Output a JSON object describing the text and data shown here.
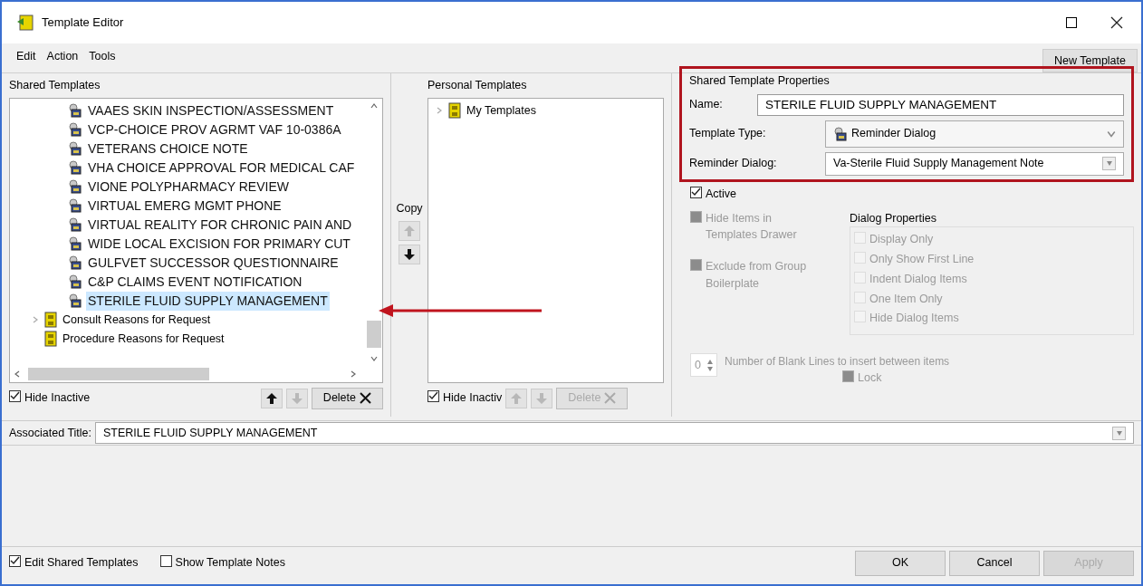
{
  "window": {
    "title": "Template Editor"
  },
  "menu": [
    "Edit",
    "Action",
    "Tools"
  ],
  "new_template_button": "New Template",
  "shared": {
    "label": "Shared Templates",
    "items": [
      {
        "kind": "template",
        "label": "VAAES SKIN INSPECTION/ASSESSMENT",
        "selected": false
      },
      {
        "kind": "template",
        "label": "VCP-CHOICE PROV AGRMT VAF 10-0386A",
        "selected": false
      },
      {
        "kind": "template",
        "label": "VETERANS CHOICE NOTE",
        "selected": false
      },
      {
        "kind": "template",
        "label": "VHA CHOICE APPROVAL FOR MEDICAL CAF",
        "selected": false
      },
      {
        "kind": "template",
        "label": "VIONE POLYPHARMACY REVIEW",
        "selected": false
      },
      {
        "kind": "template",
        "label": "VIRTUAL EMERG MGMT PHONE",
        "selected": false
      },
      {
        "kind": "template",
        "label": "VIRTUAL REALITY FOR CHRONIC PAIN AND",
        "selected": false
      },
      {
        "kind": "template",
        "label": "WIDE LOCAL EXCISION FOR PRIMARY CUT",
        "selected": false
      },
      {
        "kind": "template",
        "label": "GULFVET SUCCESSOR QUESTIONNAIRE",
        "selected": false
      },
      {
        "kind": "template",
        "label": "C&P CLAIMS EVENT NOTIFICATION",
        "selected": false
      },
      {
        "kind": "template",
        "label": "STERILE FLUID SUPPLY MANAGEMENT",
        "selected": true
      },
      {
        "kind": "folder",
        "label": "Consult Reasons for Request",
        "selected": false,
        "expandable": true
      },
      {
        "kind": "folder",
        "label": "Procedure Reasons for Request",
        "selected": false,
        "expandable": false
      }
    ],
    "hide_inactive": {
      "label": "Hide Inactive",
      "checked": true
    },
    "delete_button": "Delete",
    "up_disabled": false,
    "down_disabled": true
  },
  "copy_label": "Copy",
  "copy_left_disabled": true,
  "copy_right_disabled": false,
  "personal": {
    "label": "Personal Templates",
    "items": [
      {
        "kind": "folder",
        "label": "My Templates",
        "selected": false,
        "expandable": true
      }
    ],
    "hide_inactive": {
      "label": "Hide Inactiv",
      "checked": true
    },
    "delete_button": "Delete",
    "up_disabled": true,
    "down_disabled": true
  },
  "properties": {
    "title": "Shared Template Properties",
    "name_label": "Name:",
    "name_value": "STERILE FLUID SUPPLY MANAGEMENT",
    "type_label": "Template Type:",
    "type_value": "Reminder Dialog",
    "dialog_label": "Reminder Dialog:",
    "dialog_value": "Va-Sterile Fluid Supply Management Note"
  },
  "active": {
    "label": "Active",
    "checked": true,
    "disabled": false
  },
  "hide_items": {
    "label": "Hide Items in Templates Drawer",
    "checked": true,
    "disabled": true
  },
  "exclude": {
    "label": "Exclude from Group Boilerplate",
    "checked": true,
    "disabled": true
  },
  "dialog_properties": {
    "title": "Dialog Properties",
    "options": [
      {
        "label": "Display Only",
        "checked": false,
        "disabled": true
      },
      {
        "label": "Only Show First Line",
        "checked": false,
        "disabled": true
      },
      {
        "label": "Indent Dialog Items",
        "checked": false,
        "disabled": true
      },
      {
        "label": "One Item Only",
        "checked": false,
        "disabled": true
      },
      {
        "label": "Hide Dialog Items",
        "checked": false,
        "disabled": true
      }
    ]
  },
  "blank_lines": {
    "value": "0",
    "label": "Number of Blank Lines to insert between items"
  },
  "lock": {
    "label": "Lock",
    "checked": true,
    "disabled": true
  },
  "associated_title": {
    "label": "Associated Title:",
    "value": "STERILE FLUID SUPPLY MANAGEMENT"
  },
  "footer": {
    "edit_shared": {
      "label": "Edit Shared Templates",
      "checked": true
    },
    "show_notes": {
      "label": "Show Template Notes",
      "checked": false
    }
  },
  "buttons": [
    {
      "label": "OK",
      "disabled": false
    },
    {
      "label": "Cancel",
      "disabled": false
    },
    {
      "label": "Apply",
      "disabled": true
    }
  ]
}
